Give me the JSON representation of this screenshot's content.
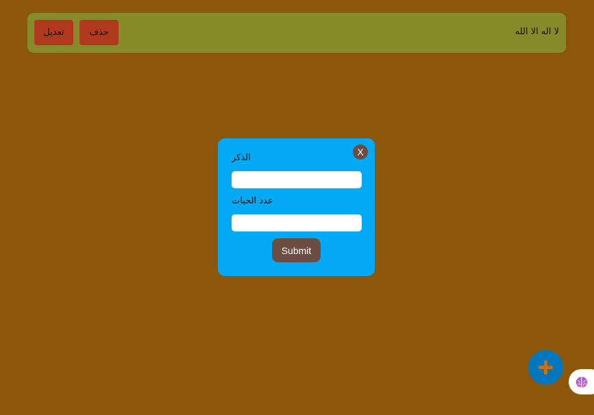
{
  "entry": {
    "dhikr_text": "لا اله الا الله",
    "edit_label": "تعديل",
    "delete_label": "حذف"
  },
  "modal": {
    "close_label": "X",
    "dhikr_label": "الذكر",
    "dhikr_value": "",
    "count_label": "عدد الحبات",
    "count_value": "",
    "submit_label": "Submit"
  },
  "fab": {
    "icon": "plus-icon"
  },
  "extension": {
    "icon": "brain-icon"
  },
  "colors": {
    "background": "#8c570b",
    "entry_card": "#878b2a",
    "action_button": "#b1391d",
    "modal": "#03a9f4",
    "modal_accent": "#6d4c41",
    "fab": "#0277bd",
    "fab_icon": "#c0731a"
  }
}
